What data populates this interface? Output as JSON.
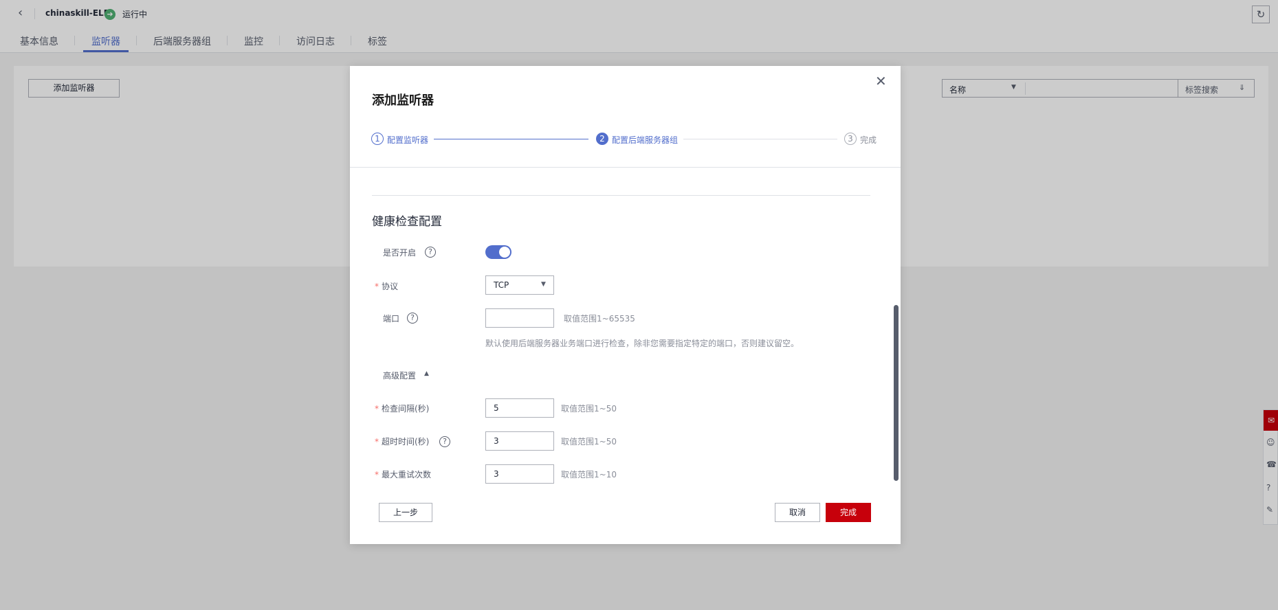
{
  "header": {
    "back_icon": "chevron-left-icon",
    "elb_name": "chinaskill-ELB",
    "status_icon": "running-arrow-icon",
    "status": "运行中",
    "refresh_icon": "refresh-icon"
  },
  "tabs": [
    {
      "label": "基本信息"
    },
    {
      "label": "监听器"
    },
    {
      "label": "后端服务器组"
    },
    {
      "label": "监控"
    },
    {
      "label": "访问日志"
    },
    {
      "label": "标签"
    }
  ],
  "active_tab": "监听器",
  "toolbar": {
    "add_listener": "添加监听器",
    "filter_field": "名称",
    "search_placeholder": "",
    "tag_search": "标签搜索"
  },
  "modal": {
    "title": "添加监听器",
    "steps": [
      {
        "num": "1",
        "label": "配置监听器",
        "state": "done"
      },
      {
        "num": "2",
        "label": "配置后端服务器组",
        "state": "active"
      },
      {
        "num": "3",
        "label": "完成",
        "state": "todo"
      }
    ],
    "section_title": "健康检查配置",
    "enable_label": "是否开启",
    "enable_value": true,
    "protocol_label": "协议",
    "protocol_value": "TCP",
    "port_label": "端口",
    "port_value": "",
    "port_hint": "取值范围1~65535",
    "port_note": "默认使用后端服务器业务端口进行检查，除非您需要指定特定的端口，否则建议留空。",
    "advanced_label": "高级配置",
    "interval_label": "检查间隔(秒)",
    "interval_value": "5",
    "interval_hint": "取值范围1~50",
    "timeout_label": "超时时间(秒)",
    "timeout_value": "3",
    "timeout_hint": "取值范围1~50",
    "retry_label": "最大重试次数",
    "retry_value": "3",
    "retry_hint": "取值范围1~10",
    "required_mark": "*",
    "buttons": {
      "prev": "上一步",
      "cancel": "取消",
      "finish": "完成"
    }
  },
  "colors": {
    "accent": "#526ecc",
    "primary_button": "#c7000b",
    "status_green": "#50b174",
    "required": "#f66f6a"
  }
}
